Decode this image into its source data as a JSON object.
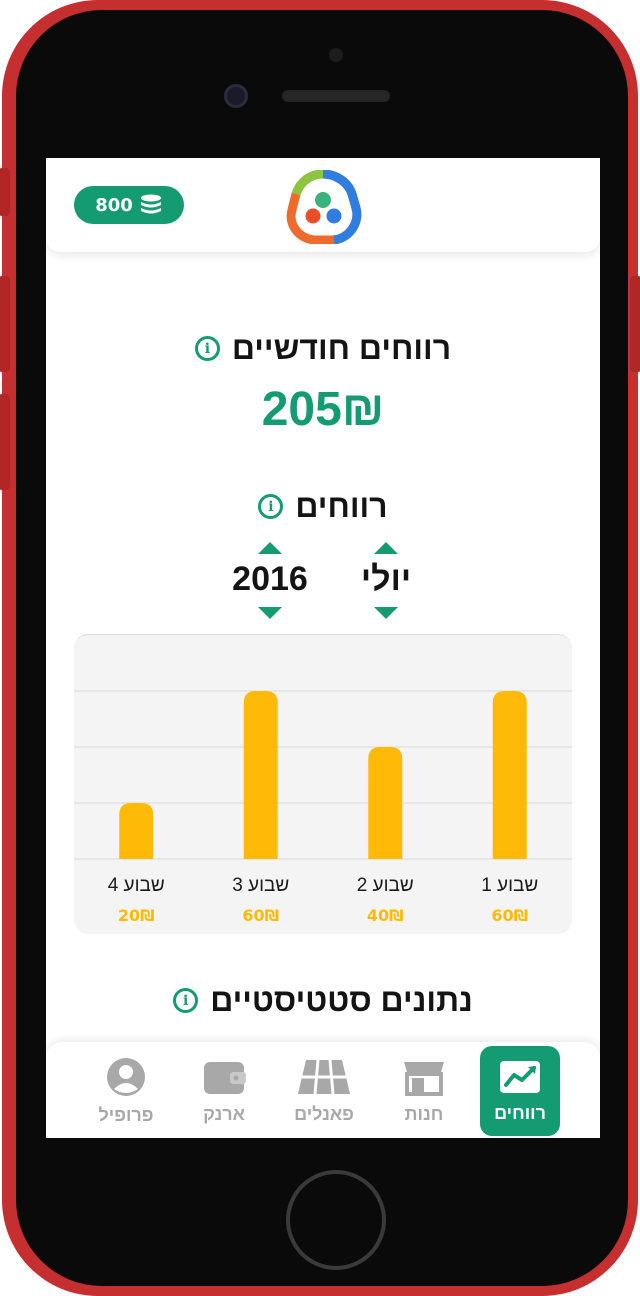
{
  "header": {
    "coins": "800",
    "coin_icon": "coins-stack-icon",
    "logo_icon": "app-logo-icon"
  },
  "monthly": {
    "title": "רווחים חודשיים",
    "value": "205₪"
  },
  "profits": {
    "title": "רווחים",
    "month": "יולי",
    "year": "2016"
  },
  "chart_data": {
    "type": "bar",
    "categories": [
      "שבוע 1",
      "שבוע 2",
      "שבוע 3",
      "שבוע 4"
    ],
    "values": [
      60,
      40,
      60,
      20
    ],
    "value_labels": [
      "60₪",
      "40₪",
      "60₪",
      "20₪"
    ],
    "ylim": [
      0,
      60
    ],
    "grid": true,
    "direction": "rtl",
    "bar_color": "#ffba08"
  },
  "stats": {
    "title": "נתונים סטטיסטיים"
  },
  "tabs": [
    {
      "label": "רווחים",
      "icon": "trend-chart-icon",
      "active": true
    },
    {
      "label": "חנות",
      "icon": "store-icon",
      "active": false
    },
    {
      "label": "פאנלים",
      "icon": "solar-panel-icon",
      "active": false
    },
    {
      "label": "ארנק",
      "icon": "wallet-icon",
      "active": false
    },
    {
      "label": "פרופיל",
      "icon": "user-icon",
      "active": false
    }
  ],
  "colors": {
    "accent": "#159b72",
    "bar": "#ffba08",
    "frame": "#c62f2f"
  }
}
